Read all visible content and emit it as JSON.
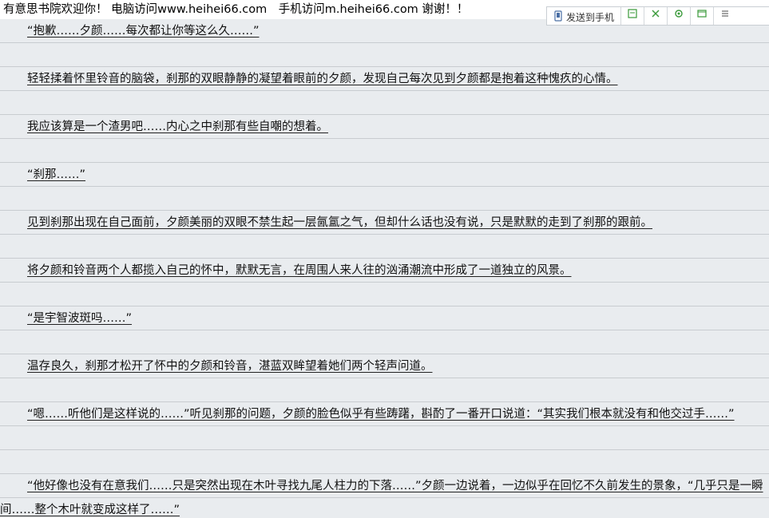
{
  "banner": {
    "text": "有意思书院欢迎你！ 电脑访问www.heihei66.com　手机访问m.heihei66.com 谢谢！！"
  },
  "toolbar": {
    "add_bookmark_label": "发送到手机",
    "icons": [
      "list-icon",
      "close-icon",
      "settings-icon",
      "window-icon",
      "scroll-icon"
    ]
  },
  "paragraphs": [
    "“抱歉……夕颜……每次都让你等这么久……”",
    "轻轻揉着怀里铃音的脑袋，刹那的双眼静静的凝望着眼前的夕颜，发现自己每次见到夕颜都是抱着这种愧疚的心情。",
    "我应该算是一个渣男吧……内心之中刹那有些自嘲的想着。",
    "“刹那……”",
    "见到刹那出现在自己面前，夕颜美丽的双眼不禁生起一层氤氲之气，但却什么话也没有说，只是默默的走到了刹那的跟前。",
    "将夕颜和铃音两个人都揽入自己的怀中，默默无言，在周围人来人往的汹涌潮流中形成了一道独立的风景。",
    "“是宇智波斑吗……”",
    "温存良久，刹那才松开了怀中的夕颜和铃音，湛蓝双眸望着她们两个轻声问道。",
    "“嗯……听他们是这样说的……”听见刹那的问题，夕颜的脸色似乎有些踌躇，斟酌了一番开口说道：“其实我们根本就没有和他交过手……”",
    "“他好像也没有在意我们……只是突然出现在木叶寻找九尾人柱力的下落……”夕颜一边说着，一边似乎在回忆不久前发生的景象，“几乎只是一瞬间……整个木叶就变成这样了……”"
  ]
}
